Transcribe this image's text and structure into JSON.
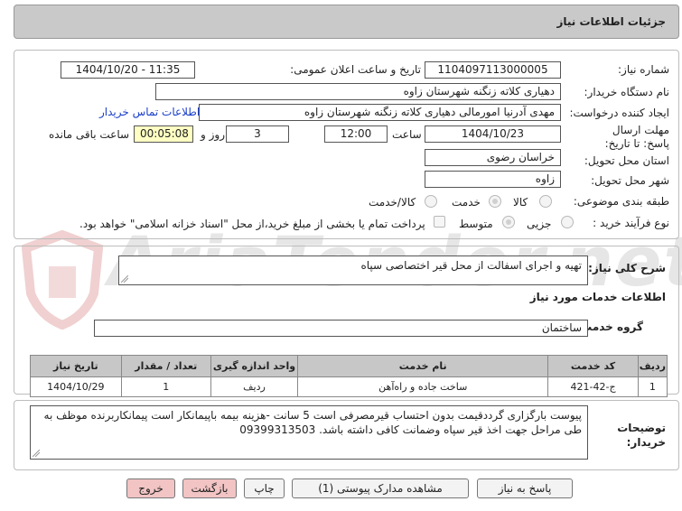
{
  "header": {
    "title": "جزئیات اطلاعات نیاز"
  },
  "watermark": {
    "text": "AriaTender.net"
  },
  "form": {
    "need_number_label": "شماره نیاز:",
    "need_number": "1104097113000005",
    "announce_label": "تاریخ و ساعت اعلان عمومی:",
    "announce_value": "1404/10/20 - 11:35",
    "buyer_org_label": "نام دستگاه خریدار:",
    "buyer_org": "دهیاری کلاته زنگنه شهرستان زاوه",
    "creator_label": "ایجاد کننده درخواست:",
    "creator": "مهدی آدرنیا امورمالی دهیاری کلاته زنگنه شهرستان زاوه",
    "contact_link": "اطلاعات تماس خریدار",
    "deadline_label": "مهلت ارسال پاسخ: تا تاریخ:",
    "deadline_date": "1404/10/23",
    "time_label": "ساعت",
    "deadline_time": "12:00",
    "days_value": "3",
    "days_label": "روز و",
    "remaining_value": "00:05:08",
    "remaining_label": "ساعت باقی مانده",
    "province_label": "استان محل تحویل:",
    "province": "خراسان رضوی",
    "city_label": "شهر محل تحویل:",
    "city": "زاوه",
    "category_label": "طبقه بندی موضوعی:",
    "category_options": [
      "کالا",
      "خدمت",
      "کالا/خدمت"
    ],
    "category_selected": "خدمت",
    "process_label": "نوع فرآیند خرید :",
    "process_options": [
      "جزیی",
      "متوسط"
    ],
    "process_selected": "متوسط",
    "payment_note": "پرداخت تمام یا بخشی از مبلغ خرید،از محل \"اسناد خزانه اسلامی\" خواهد بود."
  },
  "summary": {
    "label": "شرح کلی نیاز:",
    "value": "تهیه و اجرای اسفالت از محل قیر اختصاصی سپاه"
  },
  "services": {
    "section_title": "اطلاعات خدمات مورد نیاز",
    "group_label": "گروه خدمت:",
    "group_value": "ساختمان",
    "columns": [
      "ردیف",
      "کد خدمت",
      "نام خدمت",
      "واحد اندازه گیری",
      "تعداد / مقدار",
      "تاریخ نیاز"
    ],
    "rows": [
      [
        "1",
        "ج-42-421",
        "ساخت جاده و راه‌آهن",
        "ردیف",
        "1",
        "1404/10/29"
      ]
    ]
  },
  "buyer_notes": {
    "label": "توضیحات خریدار:",
    "value": "پیوست بارگزاری گرددقیمت بدون احتساب قیرمصرفی است 5 سانت -هزینه بیمه باپیمانکار است پیمانکاربرنده موظف به طی مراحل جهت اخذ قیر سپاه وضمانت کافی داشته باشد. 09399313503"
  },
  "buttons": {
    "reply": "پاسخ به نیاز",
    "attachments": "مشاهده مدارک پیوستی (1)",
    "print": "چاپ",
    "back": "بازگشت",
    "exit": "خروج"
  },
  "colors": {
    "header_bg": "#c9c9c9",
    "remaining_bg": "#ffffc4",
    "link": "#1a3fc9",
    "red_button": "#f2c4c4"
  }
}
